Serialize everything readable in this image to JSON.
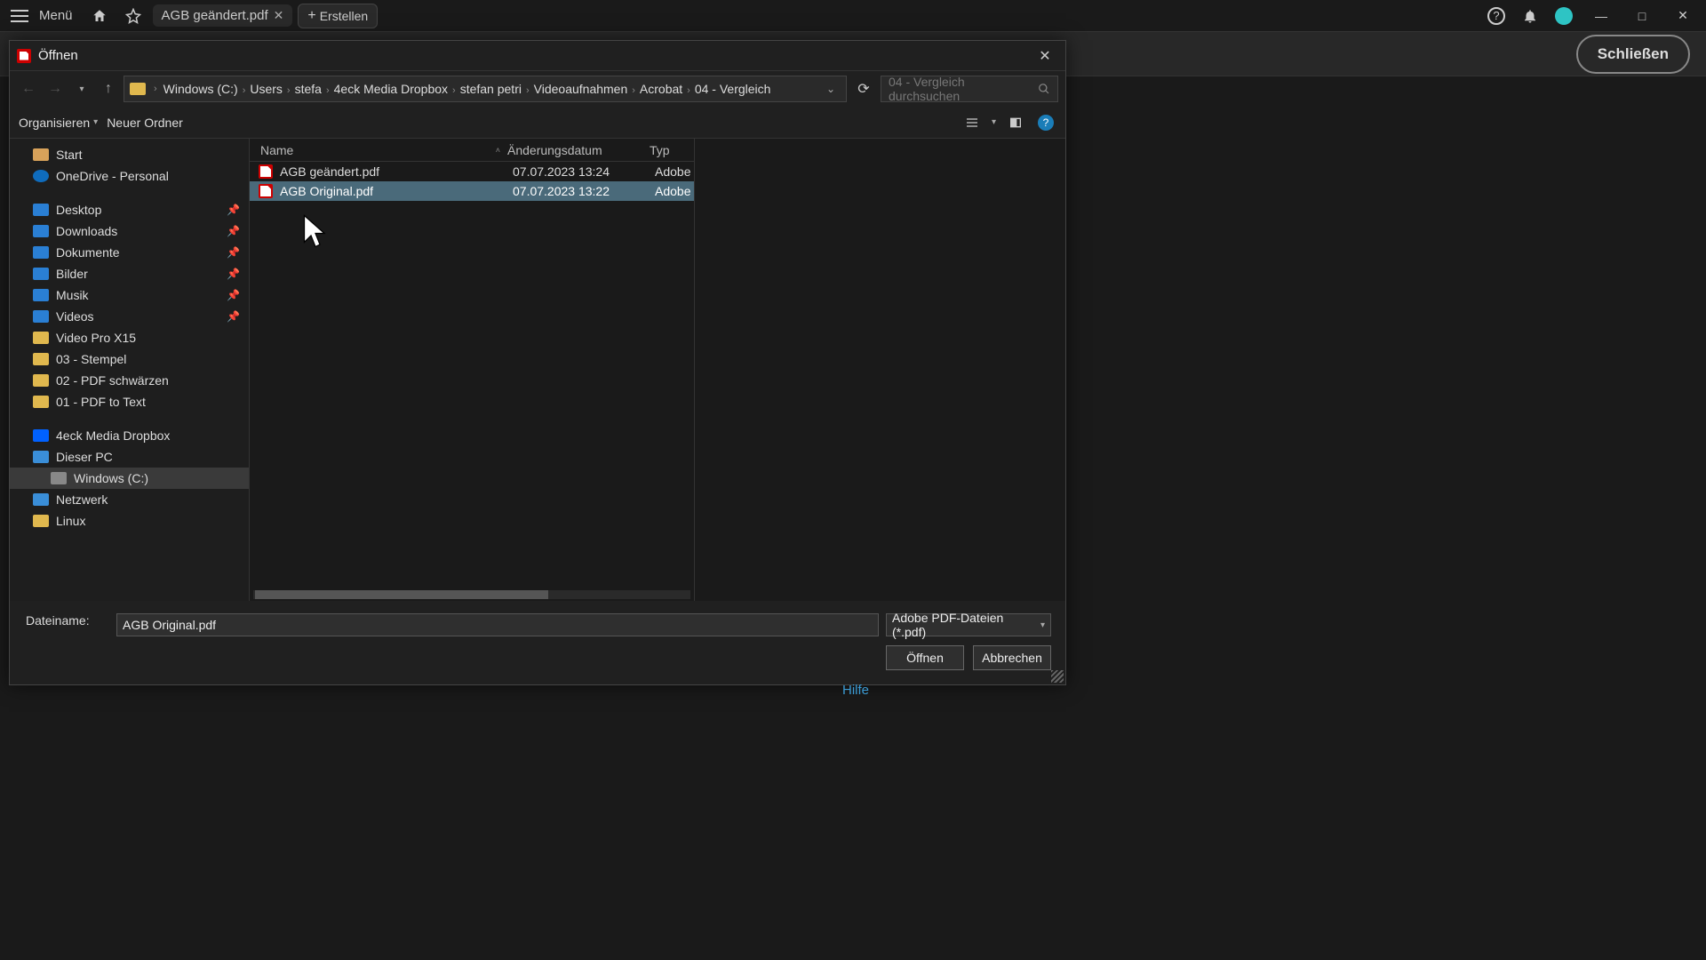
{
  "appbar": {
    "menu": "Menü",
    "tab_title": "AGB geändert.pdf",
    "create": "Erstellen"
  },
  "secbar": {
    "close": "Schließen"
  },
  "dialog": {
    "title": "Öffnen",
    "breadcrumbs": [
      "Windows (C:)",
      "Users",
      "stefa",
      "4eck Media Dropbox",
      "stefan petri",
      "Videoaufnahmen",
      "Acrobat",
      "04 - Vergleich"
    ],
    "search_placeholder": "04 - Vergleich durchsuchen",
    "organize": "Organisieren",
    "new_folder": "Neuer Ordner",
    "cols": {
      "name": "Name",
      "date": "Änderungsdatum",
      "type": "Typ"
    },
    "files": [
      {
        "name": "AGB geändert.pdf",
        "date": "07.07.2023 13:24",
        "type": "Adobe",
        "selected": false
      },
      {
        "name": "AGB Original.pdf",
        "date": "07.07.2023 13:22",
        "type": "Adobe",
        "selected": true
      }
    ],
    "sidebar": {
      "quick": [
        {
          "label": "Start",
          "ico": "ico-home"
        },
        {
          "label": "OneDrive - Personal",
          "ico": "ico-cloud"
        }
      ],
      "pinned": [
        {
          "label": "Desktop",
          "ico": "ico-desktop",
          "pin": true
        },
        {
          "label": "Downloads",
          "ico": "ico-downloads",
          "pin": true
        },
        {
          "label": "Dokumente",
          "ico": "ico-docs",
          "pin": true
        },
        {
          "label": "Bilder",
          "ico": "ico-pics",
          "pin": true
        },
        {
          "label": "Musik",
          "ico": "ico-music",
          "pin": true
        },
        {
          "label": "Videos",
          "ico": "ico-videos",
          "pin": true
        },
        {
          "label": "Video Pro X15",
          "ico": "ico-folder"
        },
        {
          "label": "03 - Stempel",
          "ico": "ico-folder"
        },
        {
          "label": "02 - PDF schwärzen",
          "ico": "ico-folder"
        },
        {
          "label": "01 - PDF to Text",
          "ico": "ico-folder"
        }
      ],
      "locations": [
        {
          "label": "4eck Media Dropbox",
          "ico": "ico-dropbox"
        },
        {
          "label": "Dieser PC",
          "ico": "ico-pc"
        },
        {
          "label": "Windows (C:)",
          "ico": "ico-drive",
          "indent": true,
          "selected": true
        },
        {
          "label": "Netzwerk",
          "ico": "ico-net"
        },
        {
          "label": "Linux",
          "ico": "ico-folder"
        }
      ]
    },
    "filename_label": "Dateiname:",
    "filename_value": "AGB Original.pdf",
    "filetype": "Adobe PDF-Dateien (*.pdf)",
    "open_btn": "Öffnen",
    "cancel_btn": "Abbrechen"
  },
  "hilfe": "Hilfe"
}
